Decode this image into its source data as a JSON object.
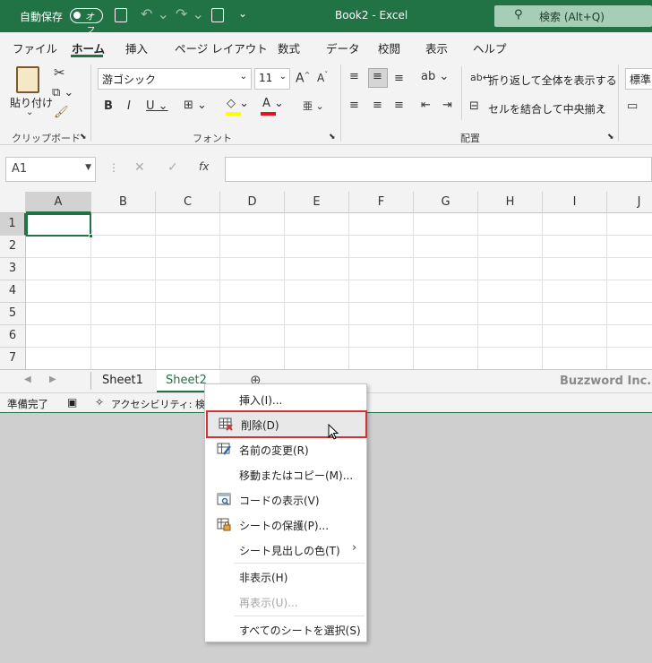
{
  "titlebar": {
    "autosave_label": "自動保存",
    "autosave_state": "オフ",
    "title": "Book2  -  Excel",
    "search_placeholder": "検索 (Alt+Q)"
  },
  "menu": {
    "tabs": [
      "ファイル",
      "ホーム",
      "挿入",
      "ページ レイアウト",
      "数式",
      "データ",
      "校閲",
      "表示",
      "ヘルプ"
    ],
    "active": "ホーム"
  },
  "ribbon": {
    "paste_label": "貼り付け",
    "clipboard_group": "クリップボード",
    "font_group": "フォント",
    "align_group": "配置",
    "font_name": "游ゴシック",
    "font_size": "11",
    "wrap_text": "折り返して全体を表示する",
    "merge_center": "セルを結合して中央揃え",
    "number_format": "標準",
    "font_color_accent": "#e81123",
    "fill_color_accent": "#ffff00"
  },
  "formula_bar": {
    "name_box": "A1",
    "fx": "fx",
    "value": ""
  },
  "grid": {
    "columns": [
      "A",
      "B",
      "C",
      "D",
      "E",
      "F",
      "G",
      "H",
      "I",
      "J"
    ],
    "rows": [
      "1",
      "2",
      "3",
      "4",
      "5",
      "6",
      "7"
    ],
    "selected_cell": "A1"
  },
  "sheets": {
    "tabs": [
      "Sheet1",
      "Sheet2"
    ],
    "active": "Sheet2",
    "watermark": "Buzzword Inc."
  },
  "status": {
    "ready": "準備完了",
    "accessibility": "アクセシビリティ: 検討"
  },
  "context_menu": {
    "items": [
      {
        "label": "挿入(I)...",
        "icon": "none",
        "disabled": false
      },
      {
        "label": "削除(D)",
        "icon": "delete-sheet-icon",
        "disabled": false,
        "highlighted": true
      },
      {
        "label": "名前の変更(R)",
        "icon": "rename-sheet-icon",
        "disabled": false
      },
      {
        "label": "移動またはコピー(M)...",
        "icon": "none",
        "disabled": false
      },
      {
        "label": "コードの表示(V)",
        "icon": "view-code-icon",
        "disabled": false
      },
      {
        "label": "シートの保護(P)...",
        "icon": "protect-sheet-icon",
        "disabled": false
      },
      {
        "label": "シート見出しの色(T)",
        "icon": "none",
        "disabled": false,
        "submenu": true
      },
      {
        "label": "非表示(H)",
        "icon": "none",
        "disabled": false
      },
      {
        "label": "再表示(U)...",
        "icon": "none",
        "disabled": true
      },
      {
        "label": "すべてのシートを選択(S)",
        "icon": "none",
        "disabled": false
      }
    ]
  }
}
